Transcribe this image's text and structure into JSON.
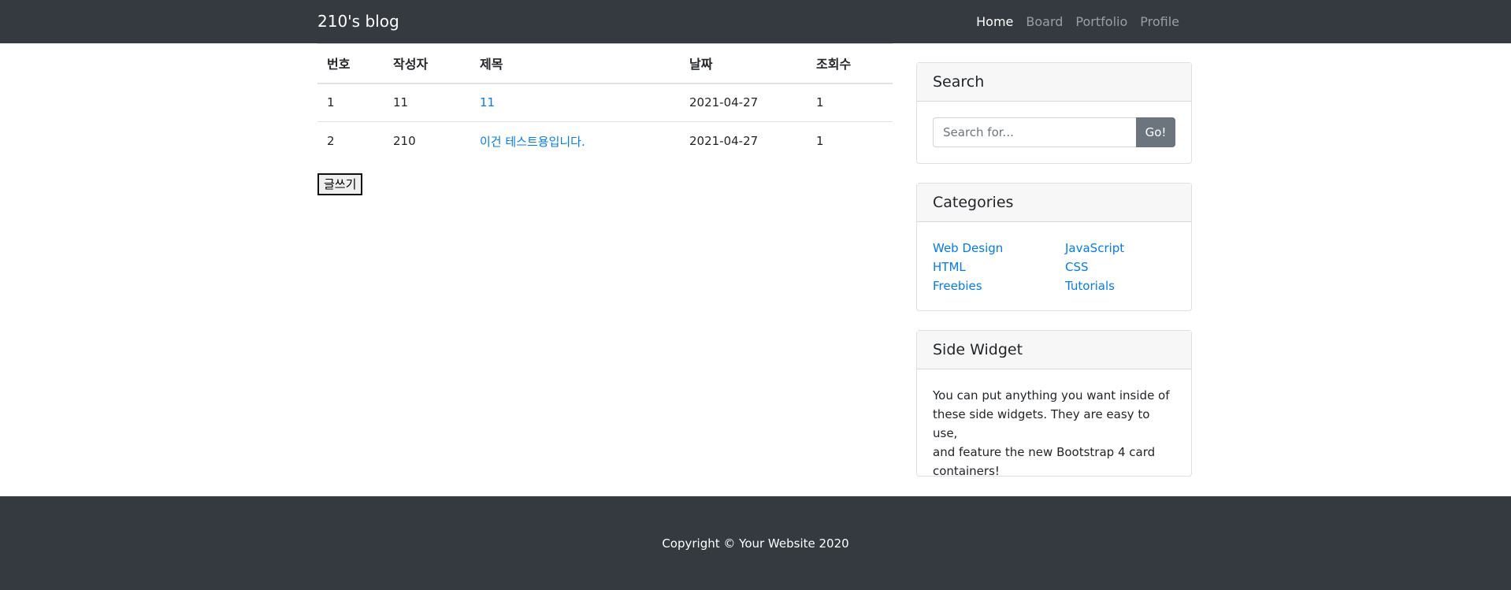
{
  "navbar": {
    "brand": "210's blog",
    "links": [
      "Home",
      "Board",
      "Portfolio",
      "Profile"
    ]
  },
  "board": {
    "headers": [
      "번호",
      "작성자",
      "제목",
      "날짜",
      "조회수"
    ],
    "rows": [
      {
        "no": "1",
        "author": "11",
        "title": "11",
        "date": "2021-04-27",
        "views": "1"
      },
      {
        "no": "2",
        "author": "210",
        "title": "이건 테스트용입니다.",
        "date": "2021-04-27",
        "views": "1"
      }
    ],
    "write_label": "글쓰기"
  },
  "search": {
    "title": "Search",
    "placeholder": "Search for...",
    "button": "Go!"
  },
  "categories": {
    "title": "Categories",
    "items": [
      "Web Design",
      "JavaScript",
      "HTML",
      "CSS",
      "Freebies",
      "Tutorials"
    ]
  },
  "side_widget": {
    "title": "Side Widget",
    "lines": [
      "You can put anything you want inside of",
      "these side widgets. They are easy to use,",
      "and feature the new Bootstrap 4 card",
      "containers!"
    ]
  },
  "footer": {
    "copyright": "Copyright © Your Website 2020"
  }
}
